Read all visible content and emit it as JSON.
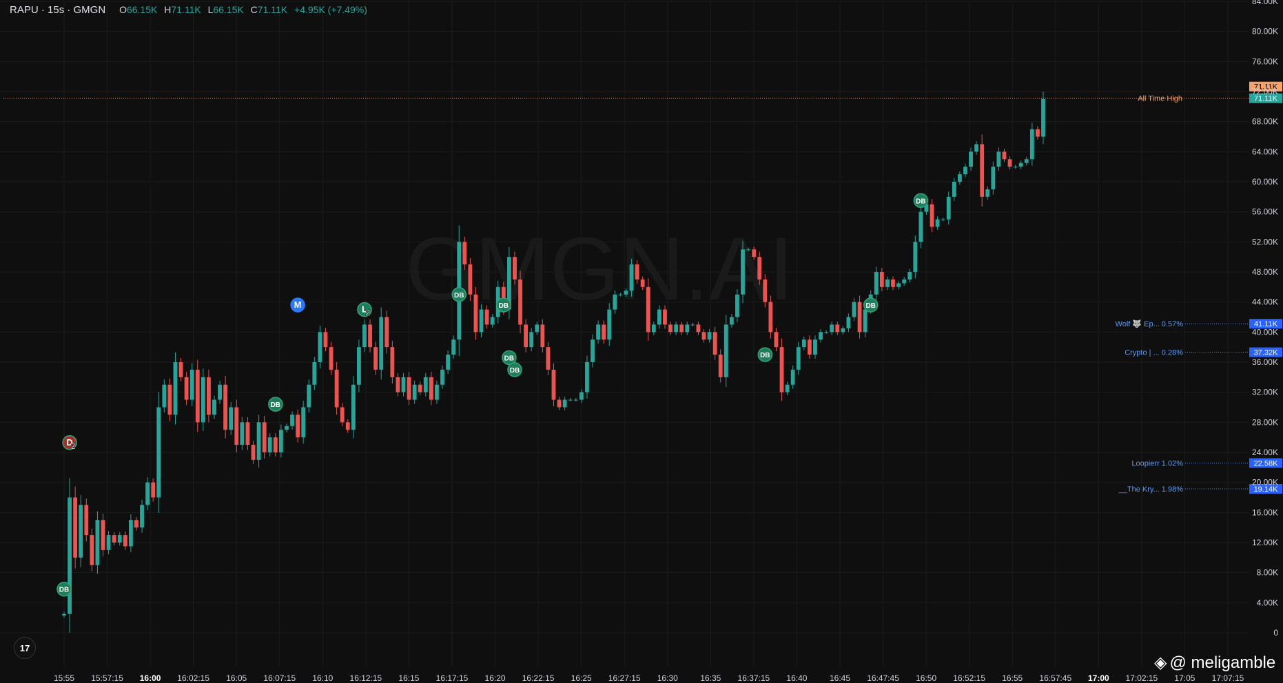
{
  "legend": {
    "symbol": "RAPU · 15s · GMGN",
    "o_label": "O",
    "o": "66.15K",
    "h_label": "H",
    "h": "71.11K",
    "l_label": "L",
    "l": "66.15K",
    "c_label": "C",
    "c": "71.11K",
    "change": "+4.95K (+7.49%)"
  },
  "background_watermark": "GMGN.AI",
  "credit": "@ meligamble",
  "tv_logo": "17",
  "colors": {
    "up": "#26a69a",
    "down": "#ef5350",
    "ath": "#f7a26b",
    "holder": "#2962ff",
    "grid": "#1c1c1c",
    "axis_text": "#d1d4dc"
  },
  "chart_data": {
    "type": "candlestick",
    "y_unit": "K",
    "ylim": [
      0,
      84
    ],
    "y_ticks": [
      "0",
      "4.00K",
      "8.00K",
      "12.00K",
      "16.00K",
      "20.00K",
      "24.00K",
      "28.00K",
      "32.00K",
      "36.00K",
      "40.00K",
      "44.00K",
      "48.00K",
      "52.00K",
      "56.00K",
      "60.00K",
      "64.00K",
      "68.00K",
      "72.00K",
      "76.00K",
      "80.00K",
      "84.00K"
    ],
    "x_ticks": [
      {
        "label": "15:55",
        "bold": false
      },
      {
        "label": "15:57:15",
        "bold": false
      },
      {
        "label": "16:00",
        "bold": true
      },
      {
        "label": "16:02:15",
        "bold": false
      },
      {
        "label": "16:05",
        "bold": false
      },
      {
        "label": "16:07:15",
        "bold": false
      },
      {
        "label": "16:10",
        "bold": false
      },
      {
        "label": "16:12:15",
        "bold": false
      },
      {
        "label": "16:15",
        "bold": false
      },
      {
        "label": "16:17:15",
        "bold": false
      },
      {
        "label": "16:20",
        "bold": false
      },
      {
        "label": "16:22:15",
        "bold": false
      },
      {
        "label": "16:25",
        "bold": false
      },
      {
        "label": "16:27:15",
        "bold": false
      },
      {
        "label": "16:30",
        "bold": false
      },
      {
        "label": "16:35",
        "bold": false
      },
      {
        "label": "16:37:15",
        "bold": false
      },
      {
        "label": "16:40",
        "bold": false
      },
      {
        "label": "16:45",
        "bold": false
      },
      {
        "label": "16:47:45",
        "bold": false
      },
      {
        "label": "16:50",
        "bold": false
      },
      {
        "label": "16:52:15",
        "bold": false
      },
      {
        "label": "16:55",
        "bold": false
      },
      {
        "label": "16:57:45",
        "bold": false
      },
      {
        "label": "17:00",
        "bold": true
      },
      {
        "label": "17:02:15",
        "bold": false
      },
      {
        "label": "17:05",
        "bold": false
      },
      {
        "label": "17:07:15",
        "bold": false
      }
    ],
    "series": [
      {
        "closes": [
          2.5,
          18,
          10,
          17,
          13,
          9,
          15,
          11,
          13,
          12,
          13,
          11.5,
          15,
          14,
          17,
          20,
          18,
          30,
          33,
          29,
          36,
          34,
          31,
          35,
          28,
          34,
          29,
          31,
          33,
          27,
          30,
          25,
          28,
          25,
          23,
          28,
          24,
          26,
          24,
          27,
          27.5,
          29,
          26,
          30,
          33,
          36,
          40,
          38,
          35,
          30,
          28,
          27,
          33,
          38,
          41,
          38,
          35,
          42,
          38,
          34,
          32,
          34,
          31,
          33,
          32,
          34,
          31,
          33,
          35,
          37,
          39,
          52,
          49,
          45,
          40,
          43,
          41,
          42,
          46,
          43,
          50,
          47,
          41,
          38,
          40,
          41,
          38,
          35,
          31,
          30,
          31,
          31,
          31,
          32,
          36,
          39,
          41,
          39,
          43,
          45,
          45,
          45.5,
          49,
          47,
          46,
          40,
          41,
          43,
          41,
          40,
          41,
          40,
          41,
          41,
          40,
          39,
          40,
          37,
          34,
          41,
          42,
          45,
          51,
          51,
          50,
          47,
          44,
          40,
          38,
          32,
          33,
          35,
          38,
          39,
          37,
          39,
          40,
          40,
          41,
          40,
          40.5,
          42,
          44,
          40,
          43,
          45,
          48,
          46,
          47,
          46,
          46.5,
          47,
          48,
          52,
          56,
          57,
          54,
          55,
          55,
          58,
          60,
          61,
          62,
          64,
          65,
          58,
          59,
          62,
          64,
          63,
          62,
          62,
          62.5,
          63,
          67,
          66,
          71
        ]
      }
    ],
    "ath": {
      "label": "All Time High",
      "value": "71.11K"
    },
    "last_price": "71.11K",
    "holder_lines": [
      {
        "label": "Wolf 🐺 Ep... 0.57%",
        "value": "41.11K"
      },
      {
        "label": "Crypto | ... 0.28%",
        "value": "37.32K"
      },
      {
        "label": "Loopierr 1.02%",
        "value": "22.58K"
      },
      {
        "label": "__The Kry... 1.98%",
        "value": "19.14K"
      }
    ],
    "markers": [
      {
        "label": "DB",
        "type": "buy",
        "candle": 0,
        "price": 5.8
      },
      {
        "label": "D",
        "badge": "2",
        "type": "sell",
        "candle": 1,
        "price": 25.3
      },
      {
        "label": "DB",
        "type": "buy",
        "candle": 38,
        "price": 30.4
      },
      {
        "label": "M",
        "type": "dev",
        "candle": 42,
        "price": 43.6
      },
      {
        "label": "L",
        "badge": "2",
        "type": "buy",
        "candle": 54,
        "price": 43.0
      },
      {
        "label": "DB",
        "type": "buy",
        "candle": 71,
        "price": 45.0
      },
      {
        "label": "DB",
        "type": "buy",
        "candle": 79,
        "price": 43.6
      },
      {
        "label": "DB",
        "type": "buy",
        "candle": 80,
        "price": 36.6
      },
      {
        "label": "DB",
        "type": "buy",
        "candle": 81,
        "price": 35.0
      },
      {
        "label": "DB",
        "type": "buy",
        "candle": 126,
        "price": 37.0
      },
      {
        "label": "DB",
        "type": "buy",
        "candle": 145,
        "price": 43.6
      },
      {
        "label": "DB",
        "type": "buy",
        "candle": 154,
        "price": 57.5
      }
    ],
    "grid": true
  }
}
